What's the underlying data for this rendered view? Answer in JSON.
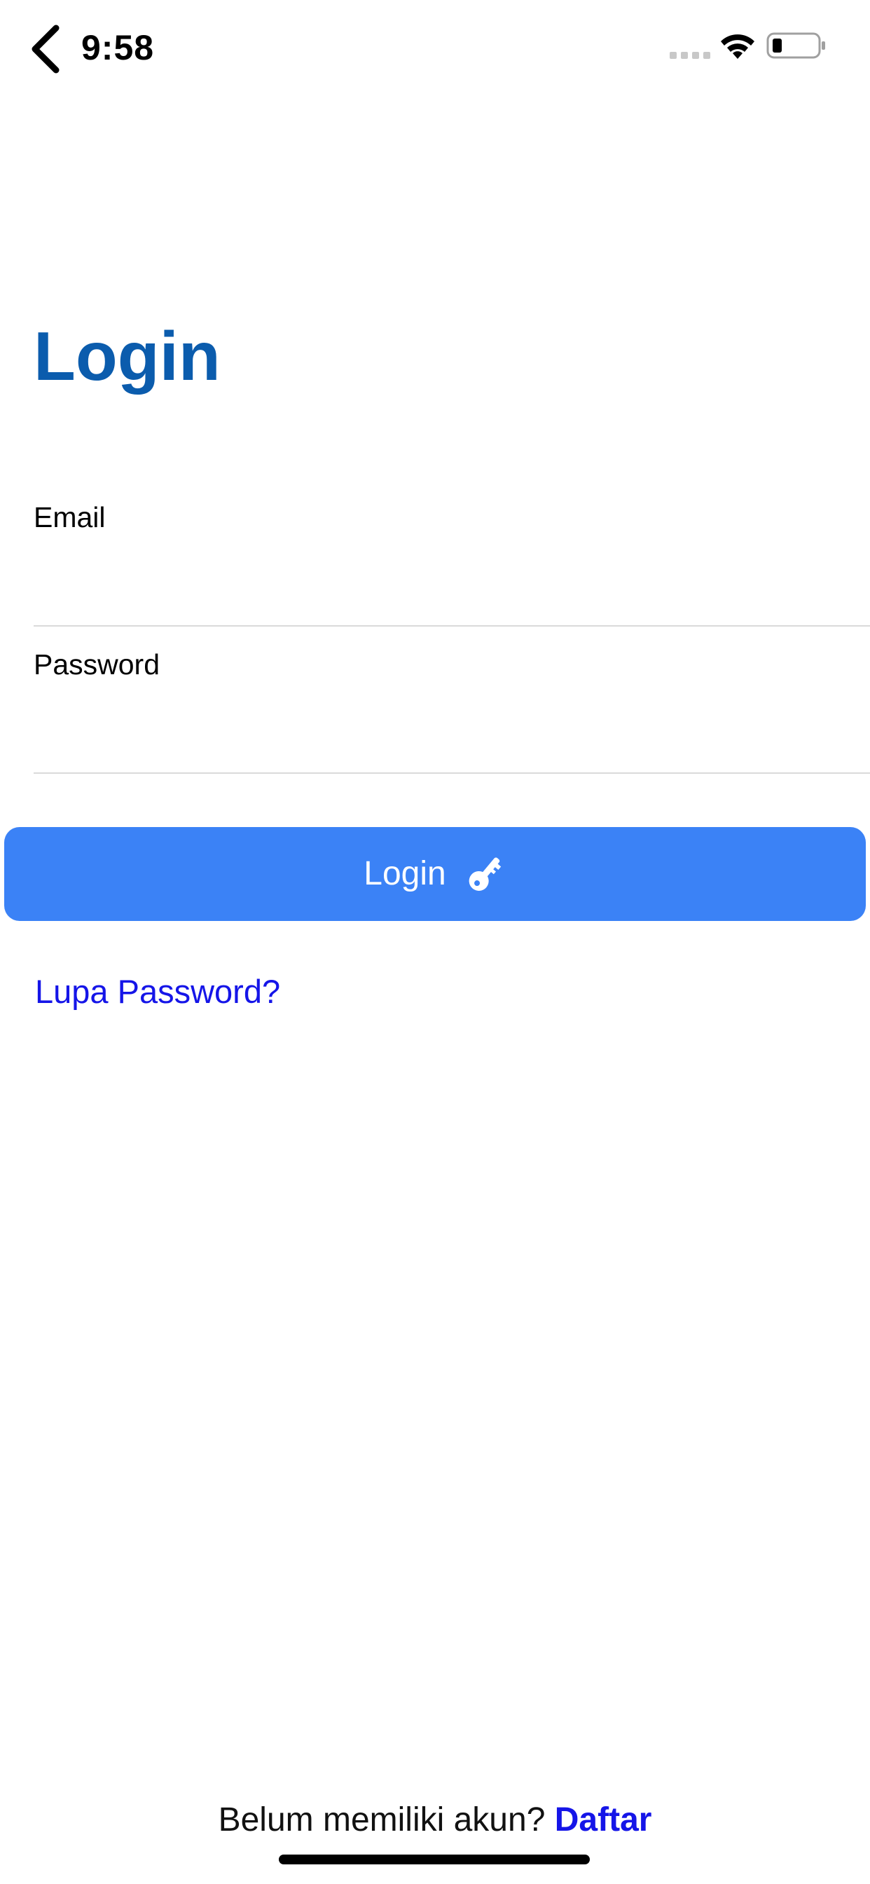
{
  "status_bar": {
    "time": "9:58",
    "back_icon": "chevron-left-icon",
    "signal_icon": "cellular-signal-icon",
    "wifi_icon": "wifi-icon",
    "battery_icon": "battery-low-icon"
  },
  "page": {
    "title": "Login"
  },
  "form": {
    "email_label": "Email",
    "email_value": "",
    "password_label": "Password",
    "password_value": ""
  },
  "login_button": {
    "label": "Login",
    "icon": "key-icon"
  },
  "forgot_password": {
    "label": "Lupa Password?"
  },
  "footer": {
    "prompt": "Belum memiliki akun?",
    "register_label": "Daftar"
  },
  "colors": {
    "title": "#0B5CAD",
    "button": "#3B82F6",
    "link": "#1515E8",
    "divider": "#DADADA"
  }
}
